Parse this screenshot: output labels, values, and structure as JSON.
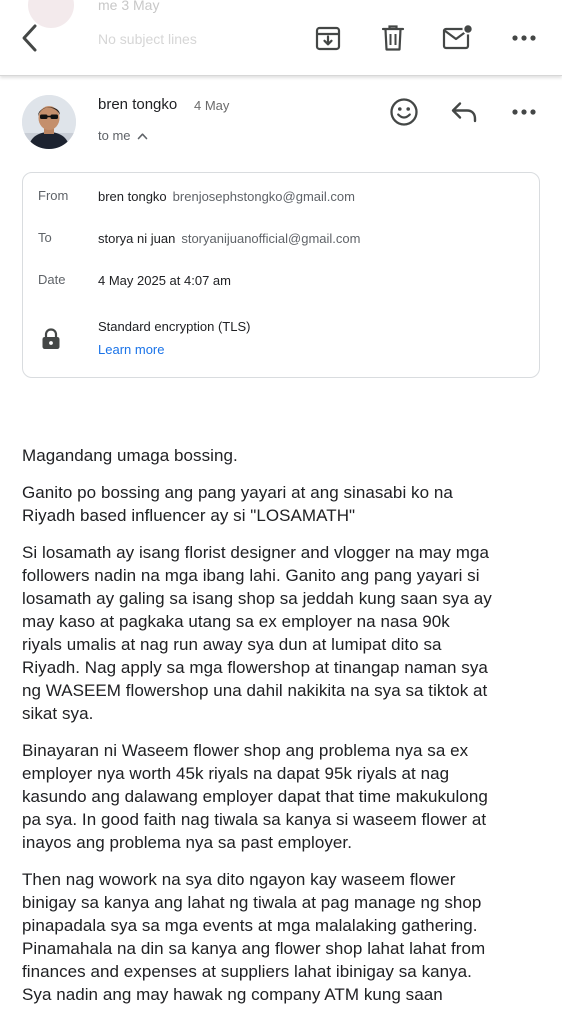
{
  "toolbar": {
    "ghost_sender": "me  3 May",
    "ghost_snippet": "No subject lines",
    "back": "back-icon",
    "archive": "archive-icon",
    "delete": "trash-icon",
    "mark_unread": "mark-unread-icon",
    "more": "more-icon"
  },
  "header": {
    "sender": "bren tongko",
    "date": "4 May",
    "to_me": "to me"
  },
  "details": {
    "from_label": "From",
    "from_name": "bren tongko",
    "from_email": "brenjosephstongko@gmail.com",
    "to_label": "To",
    "to_name": "storya ni juan",
    "to_email": "storyanijuanofficial@gmail.com",
    "date_label": "Date",
    "date_value": "4 May 2025 at 4:07 am",
    "encryption": "Standard encryption (TLS)",
    "learn_more": "Learn more"
  },
  "body": {
    "p1": "Magandang umaga bossing.",
    "p2_l1": "Ganito po bossing ang pang yayari at ang sinasabi ko na",
    "p2_l2": "Riyadh based influencer ay si \"LOSAMATH\"",
    "p3_l1": "Si losamath ay isang florist designer and vlogger na may mga",
    "p3_l2": "followers nadin na mga ibang lahi. Ganito ang pang yayari si",
    "p3_l3": "losamath ay galing sa isang shop sa jeddah kung saan sya ay",
    "p3_l4": "may kaso at pagkaka utang sa ex employer na nasa 90k",
    "p3_l5": "riyals umalis at nag run away sya dun at lumipat dito sa",
    "p3_l6": "Riyadh.  Nag apply sa mga flowershop at tinangap naman sya",
    "p3_l7": "ng WASEEM flowershop una dahil nakikita na sya sa tiktok at",
    "p3_l8": "sikat sya.",
    "p4_l1": "Binayaran ni Waseem flower shop ang problema nya sa ex",
    "p4_l2": "employer nya worth 45k riyals na dapat 95k riyals at nag",
    "p4_l3": "kasundo ang dalawang employer dapat that time makukulong",
    "p4_l4": "pa sya. In good faith nag tiwala sa kanya si waseem flower at",
    "p4_l5": "inayos ang problema nya sa past employer.",
    "p5_l1": "Then nag wowork na sya dito ngayon kay waseem flower",
    "p5_l2": "binigay sa kanya ang lahat ng tiwala at pag manage ng shop",
    "p5_l3": "pinapadala sya sa mga events at mga malalaking gathering.",
    "p5_l4": "Pinamahala na din sa kanya ang flower shop lahat lahat from",
    "p5_l5": "finances and expenses at suppliers lahat ibinigay sa kanya.",
    "p5_l6": "Sya nadin ang may hawak ng company ATM kung saan"
  },
  "colors": {
    "link": "#1a73e8",
    "icon": "#444746",
    "text": "#202124",
    "muted": "#5f6368"
  }
}
